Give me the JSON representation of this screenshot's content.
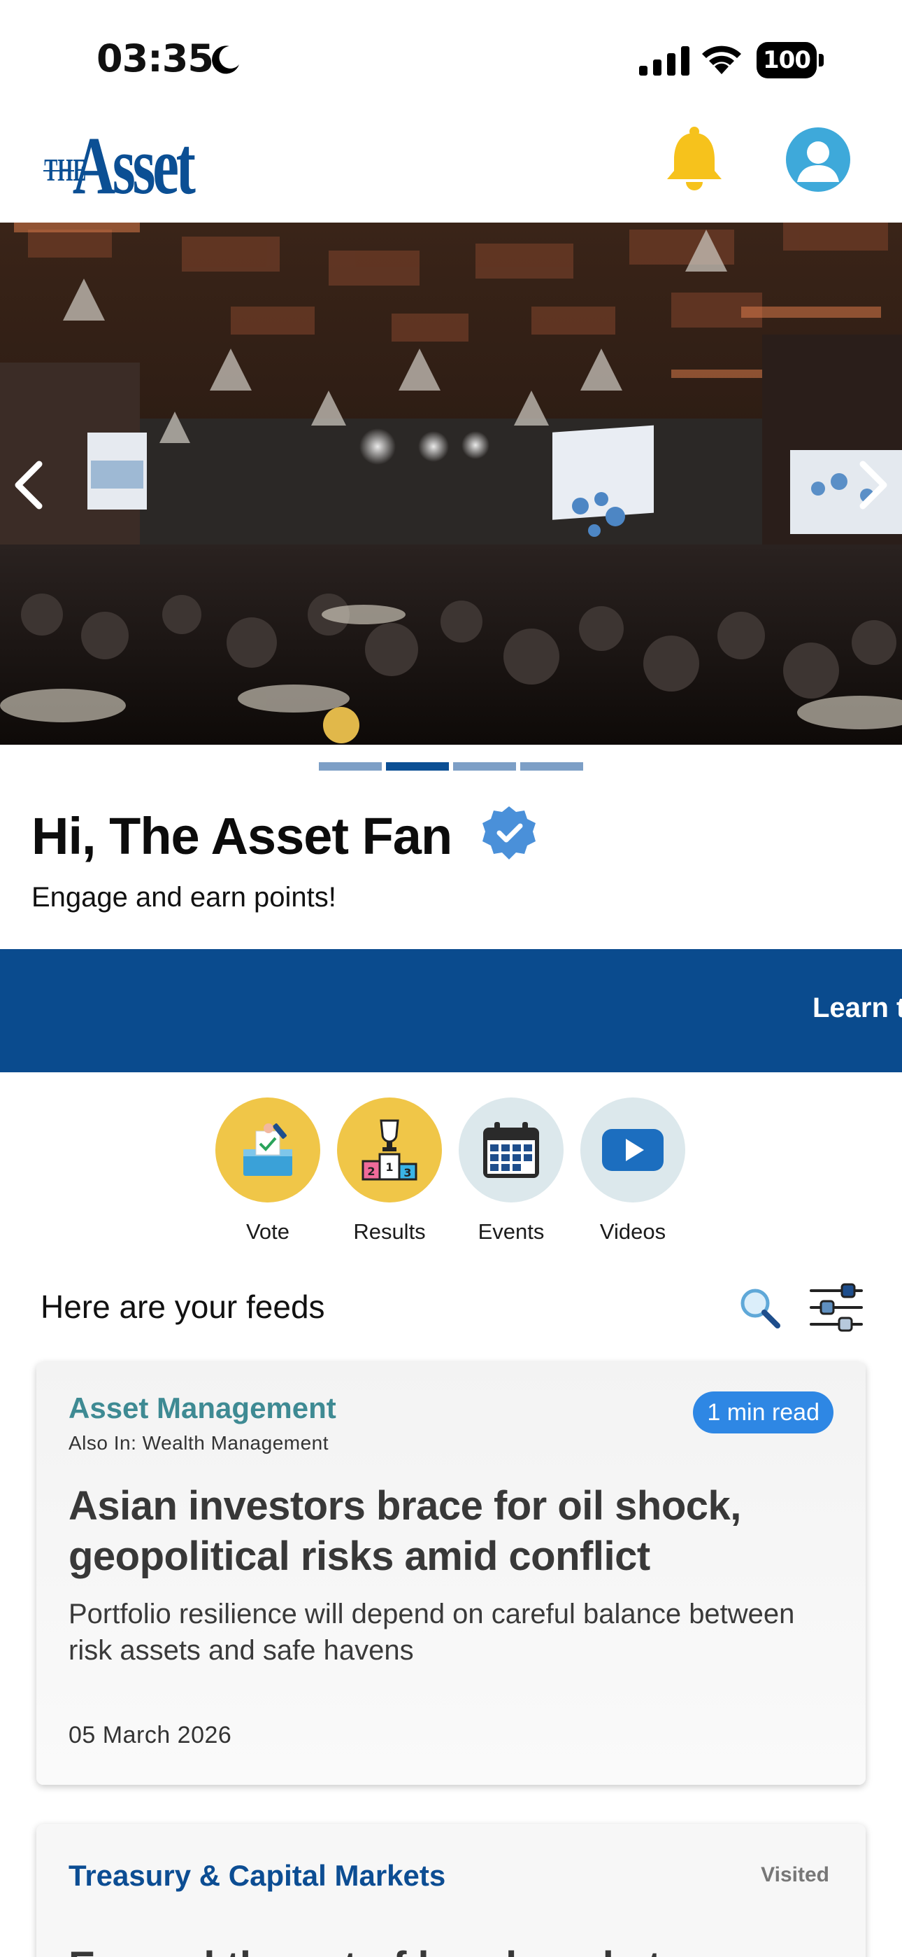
{
  "status_bar": {
    "time": "03:35",
    "battery": "100"
  },
  "header": {
    "logo_text_small": "THE",
    "logo_text_large": "Asset"
  },
  "hero": {
    "slide_count": 4,
    "active_slide": 2
  },
  "greeting": {
    "title": "Hi, The Asset Fan",
    "subtitle": "Engage and earn points!"
  },
  "banner": {
    "text": "Learn t"
  },
  "quick_actions": [
    {
      "label": "Vote",
      "icon": "ballot-box-icon",
      "bg": "#f0c648"
    },
    {
      "label": "Results",
      "icon": "trophy-podium-icon",
      "bg": "#f0c648"
    },
    {
      "label": "Events",
      "icon": "calendar-icon",
      "bg": "#dce8ec"
    },
    {
      "label": "Videos",
      "icon": "play-video-icon",
      "bg": "#dce8ec"
    }
  ],
  "feeds": {
    "title": "Here are your feeds",
    "items": [
      {
        "category": "Asset Management",
        "also_in": "Also In: Wealth Management",
        "badge": "1 min read",
        "headline": "Asian investors brace for oil shock, geopolitical risks amid conflict",
        "summary": "Portfolio resilience will depend on careful balance between risk assets and safe havens",
        "date": "05 March 2026"
      },
      {
        "category": "Treasury & Capital Markets",
        "status": "Visited",
        "headline": "Expand the set of bond market"
      }
    ]
  },
  "colors": {
    "brand_blue": "#0a4b8e",
    "teal_category": "#3e8a93",
    "badge_blue": "#2e87e4",
    "bell_yellow": "#f6c21c",
    "avatar_blue": "#3ea9da"
  }
}
